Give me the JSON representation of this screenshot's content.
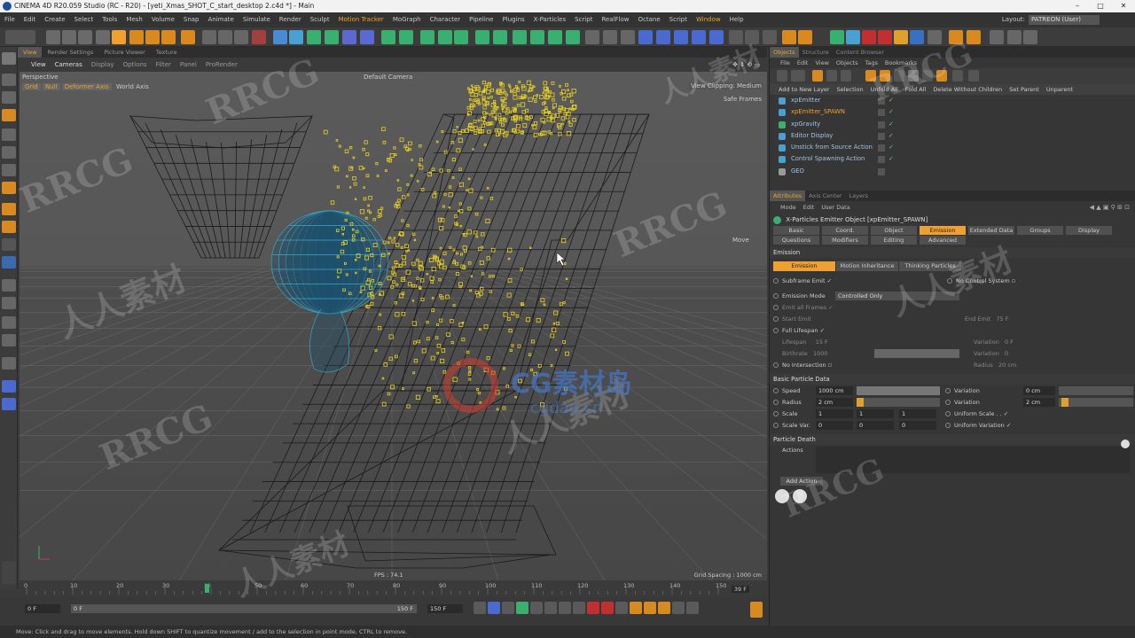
{
  "window": {
    "title": "CINEMA 4D R20.059 Studio (RC - R20) - [yeti_Xmas_SHOT_C_start_desktop 2.c4d *] - Main",
    "controls": [
      "–",
      "□",
      "✕"
    ]
  },
  "menubar": {
    "items": [
      "File",
      "Edit",
      "Create",
      "Select",
      "Tools",
      "Mesh",
      "Volume",
      "Snap",
      "Animate",
      "Simulate",
      "Render",
      "Sculpt",
      "Motion Tracker",
      "MoGraph",
      "Character",
      "Pipeline",
      "Plugins",
      "X-Particles",
      "Script",
      "RealFlow",
      "Octane",
      "Script",
      "Window",
      "Help"
    ],
    "layout_label": "Layout:",
    "layout_value": "PATREON (User)"
  },
  "viewport": {
    "tabs": [
      "View",
      "Render Settings",
      "Picture Viewer",
      "Texture"
    ],
    "menu": [
      "View",
      "Cameras",
      "Display",
      "Options",
      "Filter",
      "Panel",
      "ProRender"
    ],
    "perspective_label": "Perspective",
    "camera_label": "Default Camera",
    "snap_toggles": [
      "Grid",
      "Null",
      "Deformer Axis",
      "World Axis"
    ],
    "view_clipping": "View Clipping: Medium",
    "safe_frames": "Safe Frames",
    "tool_hint": "Move",
    "fps": "FPS : 74.1",
    "grid_spacing": "Grid Spacing : 1000 cm"
  },
  "timeline": {
    "ticks": [
      "0",
      "10",
      "20",
      "30",
      "39",
      "50",
      "60",
      "70",
      "80",
      "90",
      "100",
      "110",
      "120",
      "130",
      "140",
      "150"
    ],
    "current_frame": "39 F",
    "start_field": "0 F",
    "range_start": "0 F",
    "range_end": "150 F",
    "end_field": "150 F"
  },
  "objects_panel": {
    "tabs": [
      "Objects",
      "Structure",
      "Content Browser"
    ],
    "menu": [
      "File",
      "Edit",
      "View",
      "Objects",
      "Tags",
      "Bookmarks"
    ],
    "actions": [
      "Add to New Layer",
      "Selection",
      "Unfold All",
      "Fold All",
      "Delete Without Children",
      "Set Parent",
      "Unparent"
    ],
    "objects": [
      {
        "name": "xpEmitter",
        "selected": false
      },
      {
        "name": "xpEmitter_SPAWN",
        "selected": true
      },
      {
        "name": "xpGravity",
        "selected": false
      },
      {
        "name": "Editor Display",
        "selected": false
      },
      {
        "name": "Unstick from Source Action",
        "selected": false
      },
      {
        "name": "Control Spawning Action",
        "selected": false
      },
      {
        "name": "GEO",
        "selected": false
      }
    ]
  },
  "attributes_panel": {
    "tabs": [
      "Attributes",
      "Axis Center",
      "Layers"
    ],
    "menu": [
      "Mode",
      "Edit",
      "User Data"
    ],
    "object_title": "X-Particles Emitter Object [xpEmitter_SPAWN]",
    "subtabs_row1": [
      "Basic",
      "Coord.",
      "Object",
      "Emission",
      "Extended Data",
      "Groups",
      "Display"
    ],
    "subtabs_row2": [
      "Questions",
      "Modifiers",
      "Editing",
      "Advanced"
    ],
    "active_subtab": "Emission",
    "section_emission": "Emission",
    "emission_tabs": [
      "Emission",
      "Motion Inheritance",
      "Thinking Particles"
    ],
    "subframe_emit": "Subframe Emit",
    "no_control_system": "No Control System",
    "emission_mode_label": "Emission Mode",
    "emission_mode_value": "Controlled Only",
    "emit_all_frames": "Emit all Frames",
    "start_emit": "Start Emit",
    "end_emit": "End Emit",
    "end_emit_value": "75 F",
    "full_lifespan": "Full Lifespan",
    "lifespan": "Lifespan",
    "lifespan_value": "15 F",
    "lifespan_variation": "Variation",
    "lifespan_variation_value": "0 F",
    "birthrate": "Birthrate",
    "birthrate_value": "1000",
    "birthrate_variation": "Variation",
    "birthrate_variation_value": "0",
    "no_intersection": "No Intersection",
    "radius_dim": "Radius",
    "radius_dim_value": "20 cm",
    "section_basic": "Basic Particle Data",
    "speed_label": "Speed",
    "speed_value": "1000 cm",
    "speed_variation_label": "Variation",
    "speed_variation_value": "0 cm",
    "radius_label": "Radius",
    "radius_value": "2 cm",
    "radius_variation_label": "Variation",
    "radius_variation_value": "2 cm",
    "scale_label": "Scale",
    "scale_values": [
      "1",
      "1",
      "1"
    ],
    "uniform_scale": "Uniform Scale",
    "scale_var_label": "Scale Var.",
    "scale_var_values": [
      "0",
      "0",
      "0"
    ],
    "uniform_variation": "Uniform Variation",
    "section_death": "Particle Death",
    "actions_label": "Actions",
    "add_action": "Add Action"
  },
  "status_bar": "Move: Click and drag to move elements. Hold down SHIFT to quantize movement / add to the selection in point mode, CTRL to remove.",
  "watermarks": [
    "RRCG",
    "人人素材",
    "CG素材岛",
    "cgdao.cn"
  ],
  "colors": {
    "accent": "#f0a030",
    "particles": "#e8d020",
    "character": "#3aa8c8"
  }
}
